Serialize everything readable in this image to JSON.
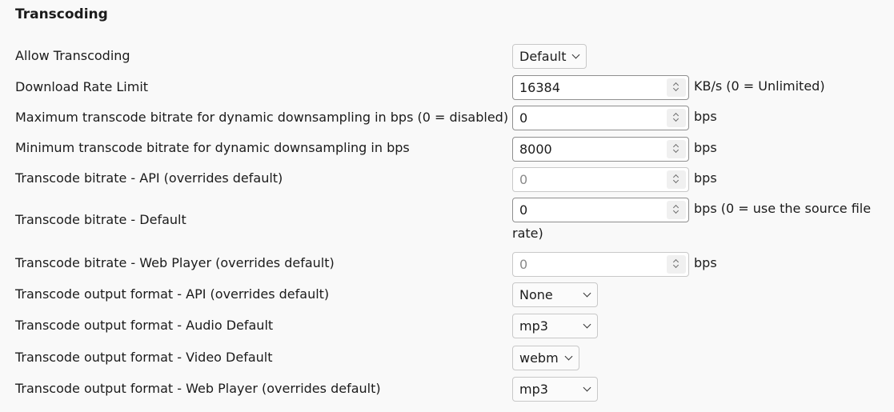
{
  "section": {
    "title": "Transcoding"
  },
  "rows": [
    {
      "label": "Allow Transcoding",
      "type": "select",
      "value": "Default"
    },
    {
      "label": "Download Rate Limit",
      "type": "number",
      "value": "16384",
      "suffix": "KB/s (0 = Unlimited)"
    },
    {
      "label": "Maximum transcode bitrate for dynamic downsampling in bps (0 = disabled)",
      "type": "number",
      "value": "0",
      "suffix": "bps"
    },
    {
      "label": "Minimum transcode bitrate for dynamic downsampling in bps",
      "type": "number",
      "value": "8000",
      "suffix": "bps"
    },
    {
      "label": "Transcode bitrate - API (overrides default)",
      "type": "number",
      "value": "",
      "placeholder": "0",
      "disabled": true,
      "suffix": "bps"
    },
    {
      "label": "Transcode bitrate - Default",
      "type": "number",
      "value": "0",
      "suffix": "bps (0 = use the source file rate)"
    },
    {
      "label": "Transcode bitrate - Web Player (overrides default)",
      "type": "number",
      "value": "",
      "placeholder": "0",
      "disabled": true,
      "suffix": "bps"
    },
    {
      "label": "Transcode output format - API (overrides default)",
      "type": "select",
      "value": "None"
    },
    {
      "label": "Transcode output format - Audio Default",
      "type": "select",
      "value": "mp3"
    },
    {
      "label": "Transcode output format - Video Default",
      "type": "select",
      "value": "webm"
    },
    {
      "label": "Transcode output format - Web Player (overrides default)",
      "type": "select",
      "value": "mp3"
    }
  ],
  "icons": {
    "select_arrow": "chevron-down-icon",
    "spinner": "stepper-icon"
  }
}
